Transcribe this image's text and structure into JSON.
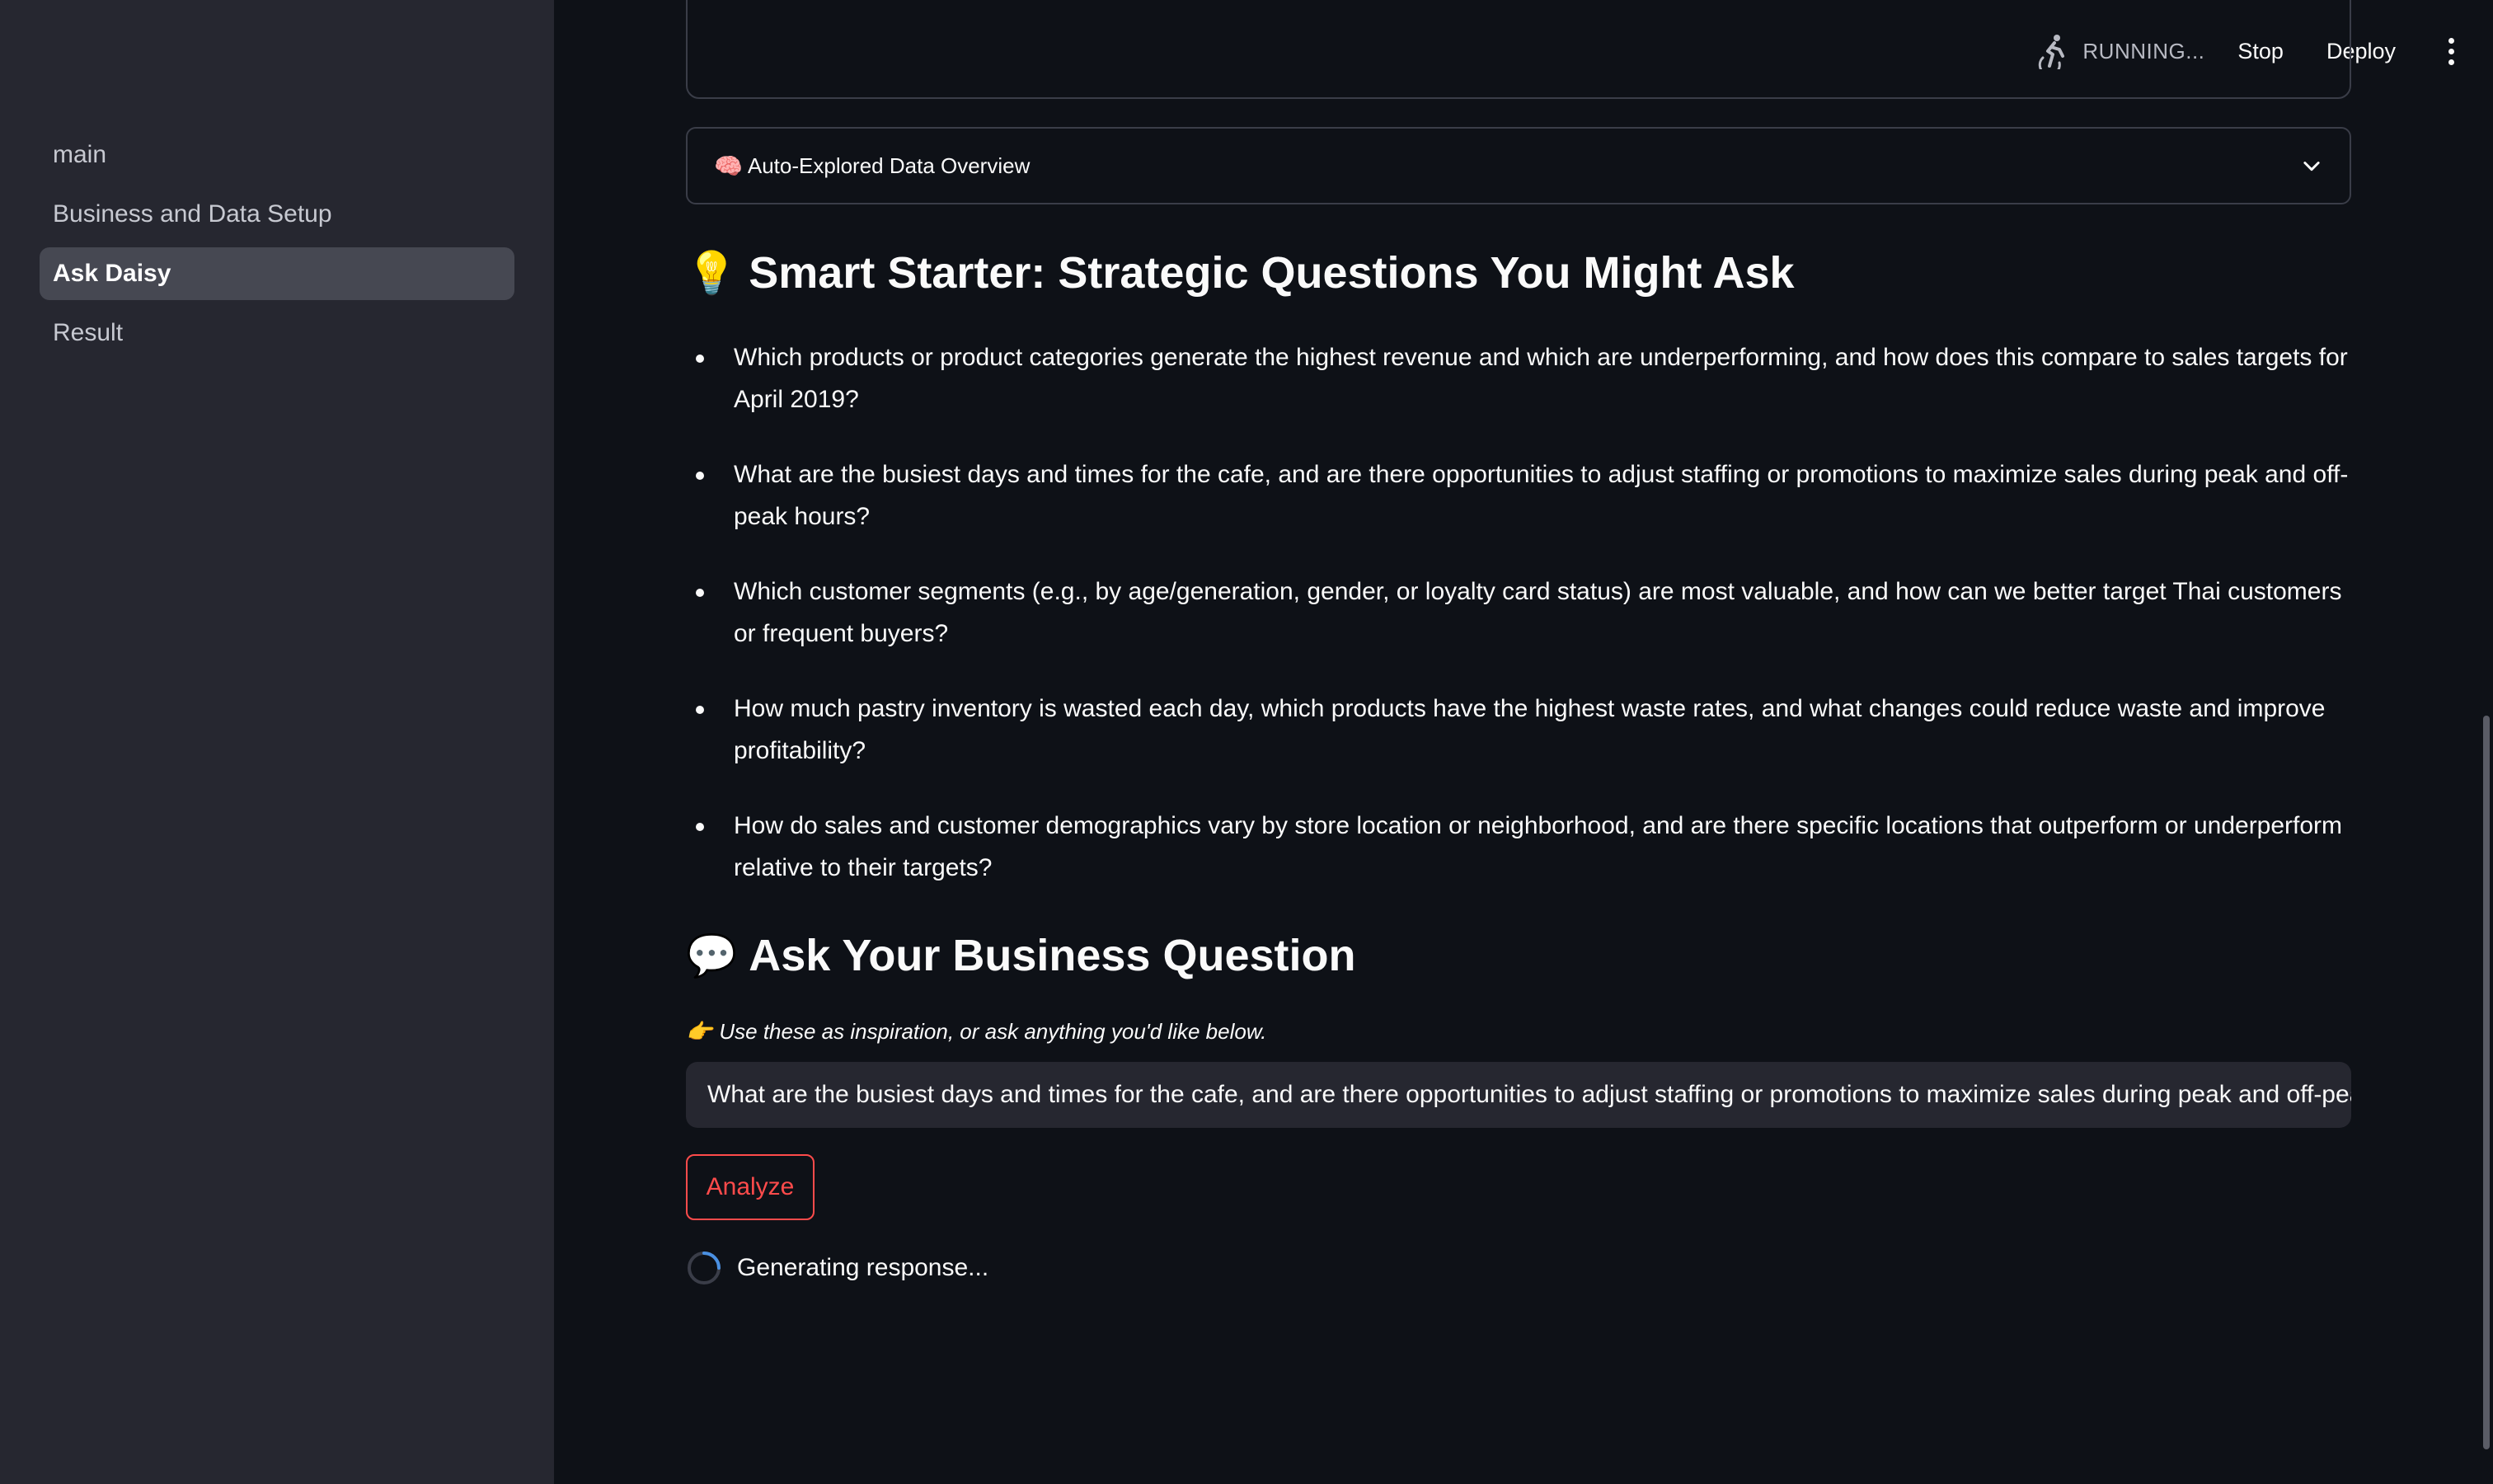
{
  "sidebar": {
    "items": [
      {
        "label": "main",
        "active": false
      },
      {
        "label": "Business and Data Setup",
        "active": false
      },
      {
        "label": "Ask Daisy",
        "active": true
      },
      {
        "label": "Result",
        "active": false
      }
    ]
  },
  "header": {
    "status_icon": "running-person-icon",
    "status": "RUNNING...",
    "stop_label": "Stop",
    "deploy_label": "Deploy",
    "menu_icon": "vertical-ellipsis-icon"
  },
  "expander": {
    "emoji": "🧠",
    "label": "Auto-Explored Data Overview",
    "icon": "chevron-down-icon"
  },
  "starter": {
    "emoji": "💡",
    "title": "Smart Starter: Strategic Questions You Might Ask",
    "questions": [
      "Which products or product categories generate the highest revenue and which are underperforming, and how does this compare to sales targets for April 2019?",
      "What are the busiest days and times for the cafe, and are there opportunities to adjust staffing or promotions to maximize sales during peak and off-peak hours?",
      "Which customer segments (e.g., by age/generation, gender, or loyalty card status) are most valuable, and how can we better target Thai customers or frequent buyers?",
      "How much pastry inventory is wasted each day, which products have the highest waste rates, and what changes could reduce waste and improve profitability?",
      "How do sales and customer demographics vary by store location or neighborhood, and are there specific locations that outperform or underperform relative to their targets?"
    ]
  },
  "ask": {
    "emoji": "💬",
    "title": "Ask Your Business Question",
    "hint_emoji": "👉",
    "hint": "Use these as inspiration, or ask anything you'd like below.",
    "input_value": "What are the busiest days and times for the cafe, and are there opportunities to adjust staffing or promotions to maximize sales during peak and off-peak hours?",
    "analyze_label": "Analyze",
    "spinner_text": "Generating response..."
  },
  "colors": {
    "background": "#0e1117",
    "sidebar": "#262730",
    "accent": "#ff4b4b",
    "spinner": "#4a90e2"
  }
}
